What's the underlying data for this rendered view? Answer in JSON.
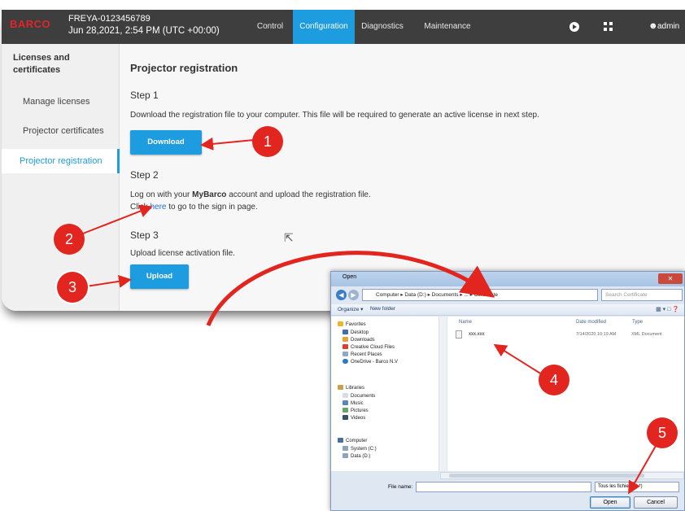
{
  "topbar": {
    "logo": "BARCO",
    "device_name": "FREYA-0123456789",
    "datetime": "Jun 28,2021, 2:54 PM (UTC +00:00)",
    "tabs": [
      "Control",
      "Configuration",
      "Diagnostics",
      "Maintenance"
    ],
    "active_tab": "Configuration",
    "user": "admin",
    "accent_color": "#1e9ce0"
  },
  "sidebar": {
    "title_line1": "Licenses and",
    "title_line2": "certificates",
    "items": [
      "Manage licenses",
      "Projector certificates",
      "Projector registration"
    ],
    "active_item": "Projector registration"
  },
  "main": {
    "title": "Projector registration",
    "step1": {
      "heading": "Step 1",
      "text": "Download the registration file to your computer. This file will be required to generate an active license in next step.",
      "button": "Download"
    },
    "step2": {
      "heading": "Step 2",
      "text_before": "Log on with your ",
      "text_bold": "MyBarco",
      "text_after": " account and upload the registration file.",
      "line2_before": "Click ",
      "link": "here",
      "line2_after": " to go to the sign in page."
    },
    "step3": {
      "heading": "Step 3",
      "text": "Upload license activation file.",
      "button": "Upload"
    }
  },
  "dialog": {
    "title": "Open",
    "address": "Computer ▸ Data (D:) ▸ Documents ▸ ... ▸ Certificate",
    "search_placeholder": "Search Certificate",
    "organize": "Organize ▾",
    "new_folder": "New folder",
    "nav": {
      "favorites": "Favorites",
      "favorites_items": [
        "Desktop",
        "Downloads",
        "Creative Cloud Files",
        "Recent Places",
        "OneDrive - Barco N.V"
      ],
      "libraries": "Libraries",
      "libraries_items": [
        "Documents",
        "Music",
        "Pictures",
        "Videos"
      ],
      "computer": "Computer",
      "computer_items": [
        "System (C:)",
        "Data (D:)"
      ]
    },
    "columns": [
      "Name",
      "Date modified",
      "Type"
    ],
    "files": [
      {
        "name": "xxx.xxx",
        "date": "7/14/2020 10:19 AM",
        "type": "XML Document"
      }
    ],
    "filename_label": "File name:",
    "filename_value": "",
    "filter": "Tous les fichiers (*.*)",
    "open_button": "Open",
    "cancel_button": "Cancel"
  },
  "callouts": [
    "1",
    "2",
    "3",
    "4",
    "5"
  ],
  "colors": {
    "callout": "#e2251f",
    "arrow": "#e2251f"
  }
}
